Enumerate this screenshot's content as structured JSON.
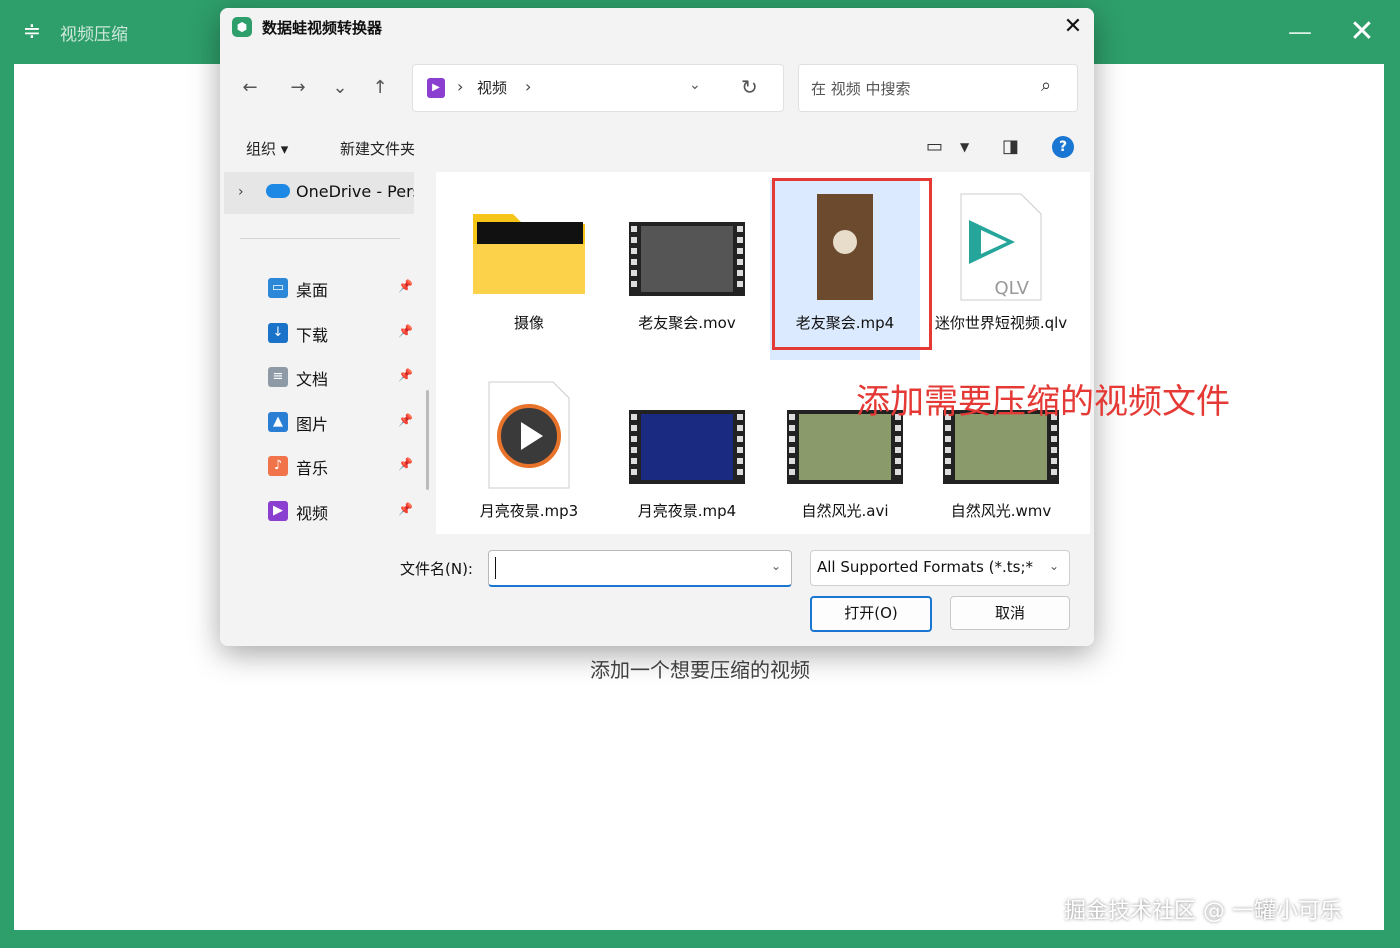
{
  "app": {
    "title": "视频压缩",
    "menu_icon": "menu-icon",
    "minimize": "—",
    "close": "✕",
    "hint": "添加一个想要压缩的视频",
    "watermark": "掘金技术社区 @ 一罐小可乐"
  },
  "dialog": {
    "title": "数据蛙视频转换器",
    "close": "✕",
    "nav": {
      "back": "←",
      "forward": "→",
      "recent": "⌄",
      "up": "↑"
    },
    "address": {
      "folder": "视频",
      "sep": "›"
    },
    "search_placeholder": "在 视频 中搜索",
    "toolbar": {
      "organize": "组织 ▾",
      "new_folder": "新建文件夹",
      "help": "?"
    },
    "sidebar": {
      "onedrive": "OneDrive - Personal",
      "items": [
        {
          "label": "桌面",
          "icon": "desktop-icon",
          "color": "#2b87d8"
        },
        {
          "label": "下载",
          "icon": "download-icon",
          "color": "#1a73c8"
        },
        {
          "label": "文档",
          "icon": "document-icon",
          "color": "#8e9aa6"
        },
        {
          "label": "图片",
          "icon": "pictures-icon",
          "color": "#2a7fd4"
        },
        {
          "label": "音乐",
          "icon": "music-icon",
          "color": "#f0734a"
        },
        {
          "label": "视频",
          "icon": "videos-icon",
          "color": "#8a3fd1"
        }
      ]
    },
    "files": [
      {
        "name": "摄像",
        "kind": "folder"
      },
      {
        "name": "老友聚会.mov",
        "kind": "video"
      },
      {
        "name": "老友聚会.mp4",
        "kind": "video",
        "selected": true
      },
      {
        "name": "迷你世界短视频.qlv",
        "kind": "qlv",
        "badge": "QLV"
      },
      {
        "name": "月亮夜景.mp3",
        "kind": "audio"
      },
      {
        "name": "月亮夜景.mp4",
        "kind": "video"
      },
      {
        "name": "自然风光.avi",
        "kind": "video"
      },
      {
        "name": "自然风光.wmv",
        "kind": "video"
      }
    ],
    "annotation": "添加需要压缩的视频文件",
    "filename_label": "文件名(N):",
    "filename_value": "",
    "format": "All Supported Formats (*.ts;*",
    "open_button": "打开(O)",
    "cancel_button": "取消"
  }
}
